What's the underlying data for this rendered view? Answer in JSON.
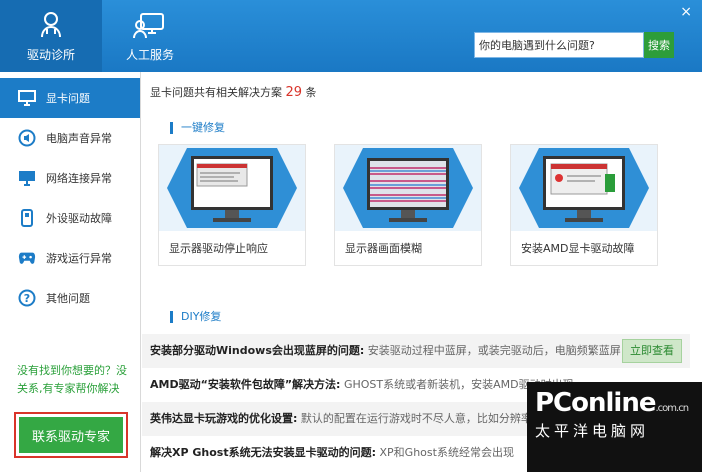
{
  "topbar": {
    "tabs": [
      {
        "label": "驱动诊所",
        "icon": "stethoscope-icon"
      },
      {
        "label": "人工服务",
        "icon": "service-icon"
      }
    ],
    "close": "×",
    "search_placeholder": "你的电脑遇到什么问题?",
    "search_button": "搜索",
    "accent": "#1c7cc7"
  },
  "sidebar": {
    "items": [
      {
        "label": "显卡问题",
        "icon": "monitor-icon"
      },
      {
        "label": "电脑声音异常",
        "icon": "speaker-icon"
      },
      {
        "label": "网络连接异常",
        "icon": "network-icon"
      },
      {
        "label": "外设驱动故障",
        "icon": "usb-icon"
      },
      {
        "label": "游戏运行异常",
        "icon": "gamepad-icon"
      },
      {
        "label": "其他问题",
        "icon": "question-icon"
      }
    ],
    "help_text": "没有找到你想要的？没关系,有专家帮你解决",
    "contact_button": "联系驱动专家"
  },
  "main": {
    "summary_prefix": "显卡问题共有相关解决方案",
    "summary_count": "29",
    "summary_suffix": "条",
    "one_click_title": "一键修复",
    "cards": [
      {
        "label": "显示器驱动停止响应"
      },
      {
        "label": "显示器画面模糊"
      },
      {
        "label": "安装AMD显卡驱动故障"
      }
    ],
    "diy_title": "DIY修复",
    "diy_rows": [
      {
        "q": "安装部分驱动Windows会出现蓝屏的问题:",
        "a": "安装驱动过程中蓝屏，或装完驱动后，电脑频繁蓝屏",
        "button": "立即查看"
      },
      {
        "q": "AMD驱动“安装软件包故障”解决方法:",
        "a": "GHOST系统或者新装机，安装AMD驱动时出现",
        "button": ""
      },
      {
        "q": "英伟达显卡玩游戏的优化设置:",
        "a": "默认的配置在运行游戏时不尽人意，比如分辨率设置",
        "button": ""
      },
      {
        "q": "解决XP Ghost系统无法安装显卡驱动的问题:",
        "a": "XP和Ghost系统经常会出现",
        "button": ""
      }
    ]
  },
  "watermark": {
    "brand": "PConline",
    "domain": ".com.cn",
    "cn": "太平洋电脑网"
  }
}
